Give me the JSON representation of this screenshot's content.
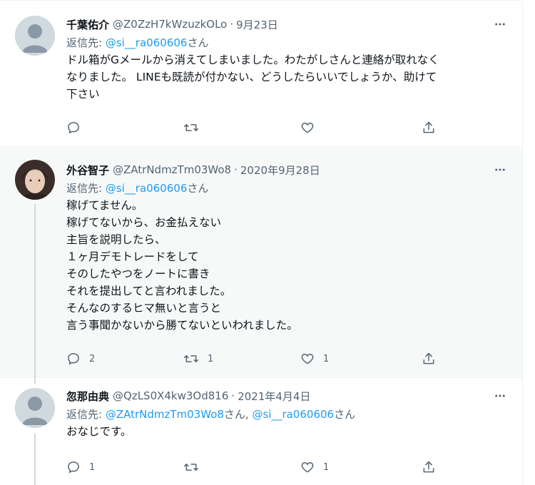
{
  "tweets": [
    {
      "name": "千葉佑介",
      "handle": "@Z0ZzH7kWzuzkOLo",
      "time": "9月23日",
      "reply_prefix": "返信先: ",
      "reply_to": "@si__ra060606",
      "reply_suffix": "さん",
      "text_lines": [
        "ドル箱がGメールから消えてしまいました。わたがしさんと連絡が取れなく",
        "なりました。 LINEも既読が付かない、どうしたらいいでしょうか、助けて",
        "下さい"
      ],
      "counts": {
        "reply": "",
        "retweet": "",
        "like": ""
      }
    },
    {
      "name": "外谷智子",
      "handle": "@ZAtrNdmzTm03Wo8",
      "time": "2020年9月28日",
      "reply_prefix": "返信先: ",
      "reply_to": "@si__ra060606",
      "reply_suffix": "さん",
      "text_lines": [
        "稼げてません。",
        "稼げてないから、お金払えない",
        "主旨を説明したら、",
        "１ヶ月デモトレードをして",
        "そのしたやつをノートに書き",
        "それを提出してと言われました。",
        "そんなのするヒマ無いと言うと",
        "言う事聞かないから勝てないといわれました。"
      ],
      "counts": {
        "reply": "2",
        "retweet": "1",
        "like": "1"
      }
    },
    {
      "name": "忽那由典",
      "handle": "@QzLS0X4kw3Od816",
      "time": "2021年4月4日",
      "reply_prefix": "返信先: ",
      "reply_to_a": "@ZAtrNdmzTm03Wo8",
      "reply_mid": "さん, ",
      "reply_to_b": "@si__ra060606",
      "reply_suffix": "さん",
      "text_lines": [
        "おなじです。"
      ],
      "counts": {
        "reply": "1",
        "retweet": "",
        "like": "1"
      }
    }
  ],
  "separator_dot": "·",
  "icons": {
    "more": "more-horizontal-icon",
    "reply": "reply-icon",
    "retweet": "retweet-icon",
    "like": "heart-icon",
    "share": "share-icon"
  },
  "colors": {
    "link": "#1d9bf0",
    "secondary_text": "#536471",
    "primary_text": "#0f1419",
    "highlight_bg": "#f7f9f9",
    "thread_line": "#cfd9de"
  }
}
